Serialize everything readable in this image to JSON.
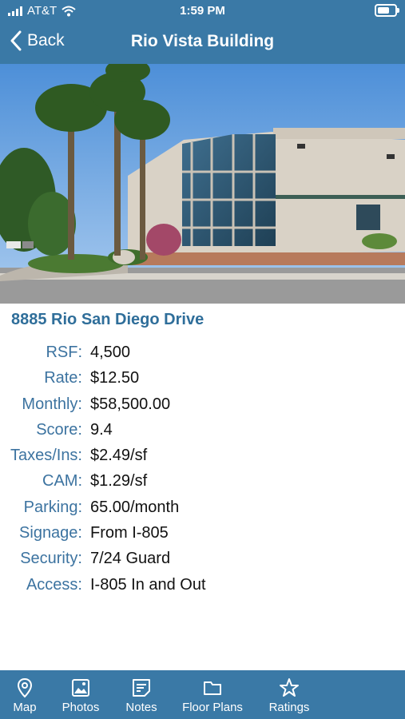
{
  "status_bar": {
    "carrier": "AT&T",
    "time": "1:59 PM"
  },
  "nav": {
    "back_label": "Back",
    "title": "Rio Vista Building"
  },
  "property": {
    "address": "8885 Rio San Diego Drive",
    "details": [
      {
        "label": "RSF:",
        "value": "4,500"
      },
      {
        "label": "Rate:",
        "value": "$12.50"
      },
      {
        "label": "Monthly:",
        "value": "$58,500.00"
      },
      {
        "label": "Score:",
        "value": "9.4"
      },
      {
        "label": "Taxes/Ins:",
        "value": "$2.49/sf"
      },
      {
        "label": "CAM:",
        "value": "$1.29/sf"
      },
      {
        "label": "Parking:",
        "value": "65.00/month"
      },
      {
        "label": "Signage:",
        "value": "From I-805"
      },
      {
        "label": "Security:",
        "value": "7/24 Guard"
      },
      {
        "label": "Access:",
        "value": "I-805 In and Out"
      }
    ]
  },
  "tabbar": {
    "tabs": [
      {
        "label": "Map",
        "icon": "map-pin-icon"
      },
      {
        "label": "Photos",
        "icon": "photo-icon"
      },
      {
        "label": "Notes",
        "icon": "notes-icon"
      },
      {
        "label": "Floor Plans",
        "icon": "folder-icon"
      },
      {
        "label": "Ratings",
        "icon": "star-icon"
      }
    ]
  },
  "colors": {
    "brand": "#3a79a6",
    "label": "#3c73a0",
    "address": "#2f6e9a"
  }
}
